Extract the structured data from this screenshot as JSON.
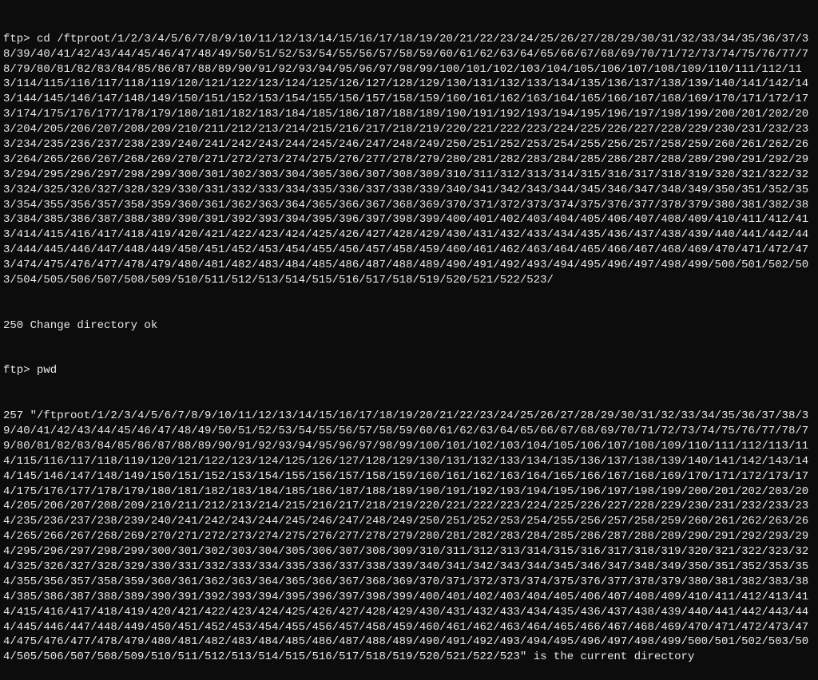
{
  "terminal": {
    "line1_prompt_cmd": "ftp> cd /ftproot/1/2/3/4/5/6/7/8/9/10/11/12/13/14/15/16/17/18/19/20/21/22/23/24/25/26/27/28/29/30/31/32/33/34/35/36/37/38/39/40/41/42/43/44/45/46/47/48/49/50/51/52/53/54/55/56/57/58/59/60/61/62/63/64/65/66/67/68/69/70/71/72/73/74/75/76/77/78/79/80/81/82/83/84/85/86/87/88/89/90/91/92/93/94/95/96/97/98/99/100/101/102/103/104/105/106/107/108/109/110/111/112/113/114/115/116/117/118/119/120/121/122/123/124/125/126/127/128/129/130/131/132/133/134/135/136/137/138/139/140/141/142/143/144/145/146/147/148/149/150/151/152/153/154/155/156/157/158/159/160/161/162/163/164/165/166/167/168/169/170/171/172/173/174/175/176/177/178/179/180/181/182/183/184/185/186/187/188/189/190/191/192/193/194/195/196/197/198/199/200/201/202/203/204/205/206/207/208/209/210/211/212/213/214/215/216/217/218/219/220/221/222/223/224/225/226/227/228/229/230/231/232/233/234/235/236/237/238/239/240/241/242/243/244/245/246/247/248/249/250/251/252/253/254/255/256/257/258/259/260/261/262/263/264/265/266/267/268/269/270/271/272/273/274/275/276/277/278/279/280/281/282/283/284/285/286/287/288/289/290/291/292/293/294/295/296/297/298/299/300/301/302/303/304/305/306/307/308/309/310/311/312/313/314/315/316/317/318/319/320/321/322/323/324/325/326/327/328/329/330/331/332/333/334/335/336/337/338/339/340/341/342/343/344/345/346/347/348/349/350/351/352/353/354/355/356/357/358/359/360/361/362/363/364/365/366/367/368/369/370/371/372/373/374/375/376/377/378/379/380/381/382/383/384/385/386/387/388/389/390/391/392/393/394/395/396/397/398/399/400/401/402/403/404/405/406/407/408/409/410/411/412/413/414/415/416/417/418/419/420/421/422/423/424/425/426/427/428/429/430/431/432/433/434/435/436/437/438/439/440/441/442/443/444/445/446/447/448/449/450/451/452/453/454/455/456/457/458/459/460/461/462/463/464/465/466/467/468/469/470/471/472/473/474/475/476/477/478/479/480/481/482/483/484/485/486/487/488/489/490/491/492/493/494/495/496/497/498/499/500/501/502/503/504/505/506/507/508/509/510/511/512/513/514/515/516/517/518/519/520/521/522/523/",
    "line2_response": "250 Change directory ok",
    "line3_prompt_cmd": "ftp> pwd",
    "line4_response": "257 \"/ftproot/1/2/3/4/5/6/7/8/9/10/11/12/13/14/15/16/17/18/19/20/21/22/23/24/25/26/27/28/29/30/31/32/33/34/35/36/37/38/39/40/41/42/43/44/45/46/47/48/49/50/51/52/53/54/55/56/57/58/59/60/61/62/63/64/65/66/67/68/69/70/71/72/73/74/75/76/77/78/79/80/81/82/83/84/85/86/87/88/89/90/91/92/93/94/95/96/97/98/99/100/101/102/103/104/105/106/107/108/109/110/111/112/113/114/115/116/117/118/119/120/121/122/123/124/125/126/127/128/129/130/131/132/133/134/135/136/137/138/139/140/141/142/143/144/145/146/147/148/149/150/151/152/153/154/155/156/157/158/159/160/161/162/163/164/165/166/167/168/169/170/171/172/173/174/175/176/177/178/179/180/181/182/183/184/185/186/187/188/189/190/191/192/193/194/195/196/197/198/199/200/201/202/203/204/205/206/207/208/209/210/211/212/213/214/215/216/217/218/219/220/221/222/223/224/225/226/227/228/229/230/231/232/233/234/235/236/237/238/239/240/241/242/243/244/245/246/247/248/249/250/251/252/253/254/255/256/257/258/259/260/261/262/263/264/265/266/267/268/269/270/271/272/273/274/275/276/277/278/279/280/281/282/283/284/285/286/287/288/289/290/291/292/293/294/295/296/297/298/299/300/301/302/303/304/305/306/307/308/309/310/311/312/313/314/315/316/317/318/319/320/321/322/323/324/325/326/327/328/329/330/331/332/333/334/335/336/337/338/339/340/341/342/343/344/345/346/347/348/349/350/351/352/353/354/355/356/357/358/359/360/361/362/363/364/365/366/367/368/369/370/371/372/373/374/375/376/377/378/379/380/381/382/383/384/385/386/387/388/389/390/391/392/393/394/395/396/397/398/399/400/401/402/403/404/405/406/407/408/409/410/411/412/413/414/415/416/417/418/419/420/421/422/423/424/425/426/427/428/429/430/431/432/433/434/435/436/437/438/439/440/441/442/443/444/445/446/447/448/449/450/451/452/453/454/455/456/457/458/459/460/461/462/463/464/465/466/467/468/469/470/471/472/473/474/475/476/477/478/479/480/481/482/483/484/485/486/487/488/489/490/491/492/493/494/495/496/497/498/499/500/501/502/503/504/505/506/507/508/509/510/511/512/513/514/515/516/517/518/519/520/521/522/523\" is the current directory"
  }
}
